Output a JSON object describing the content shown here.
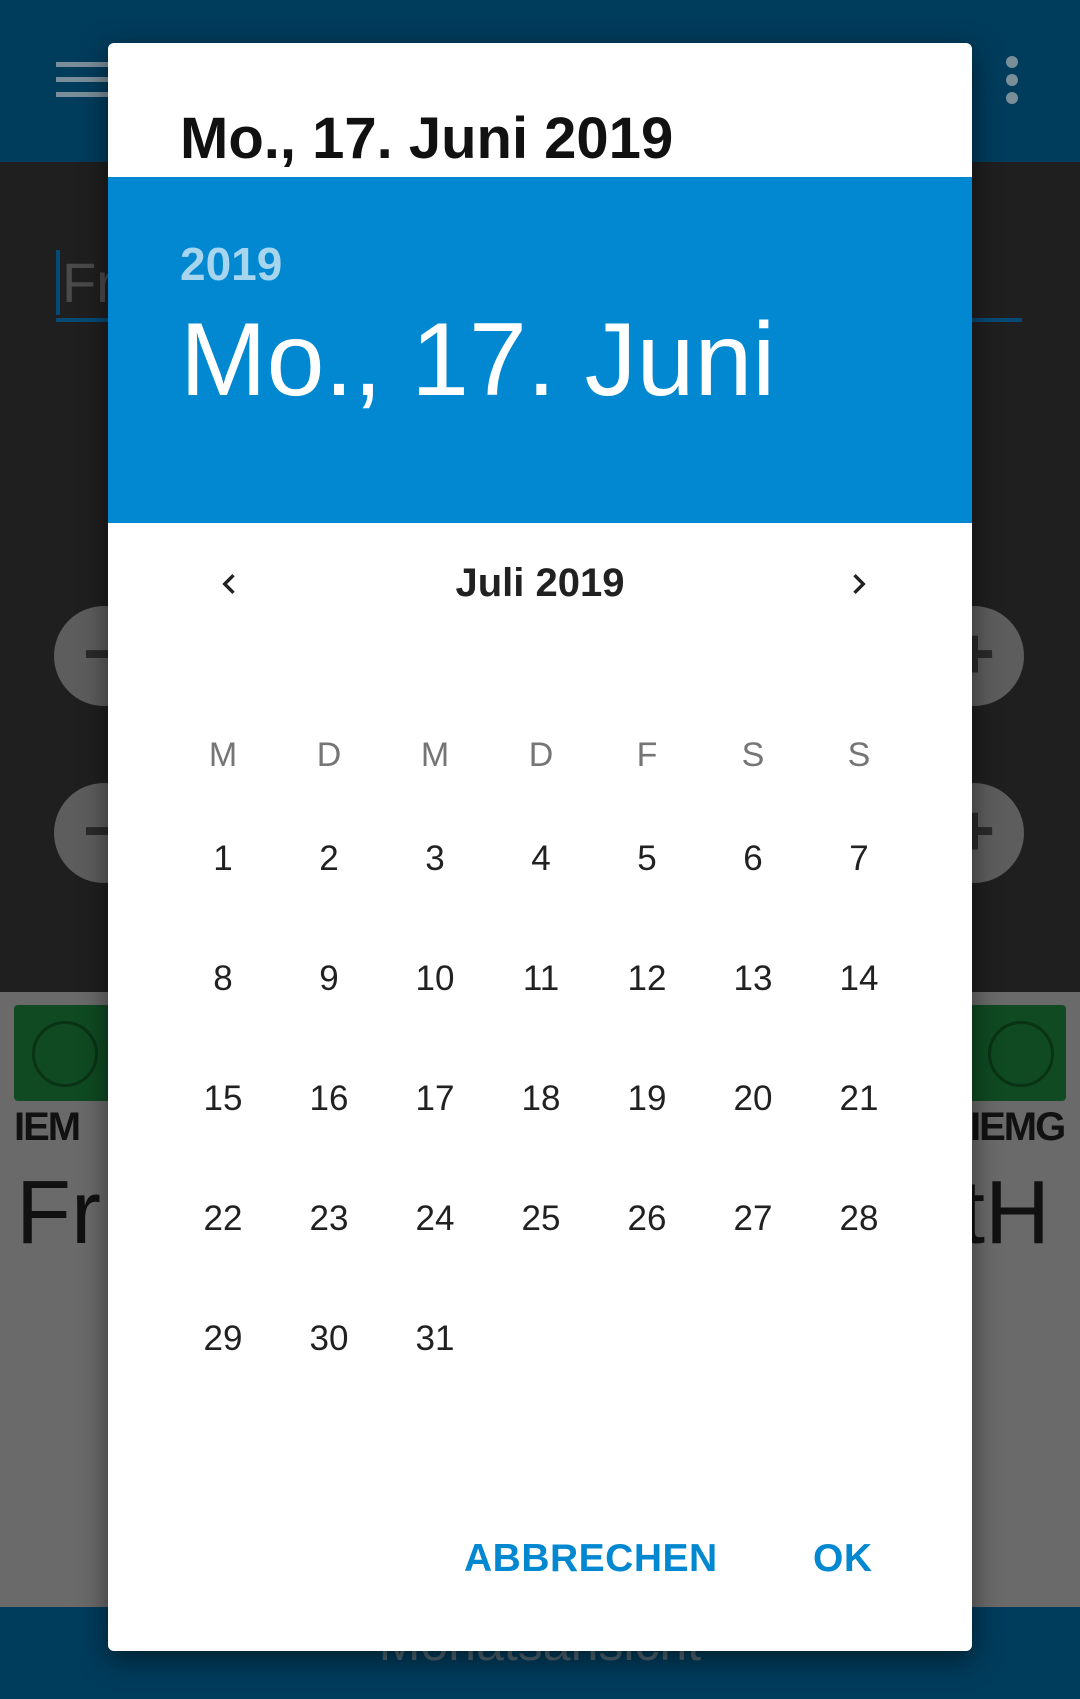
{
  "background": {
    "input_text": "Fra",
    "big_text_left": "Fr",
    "big_text_right": "tH",
    "logo_word_left": "IEM",
    "logo_word_right": "IEMG",
    "bottom_label": "Monatsansicht"
  },
  "dialog": {
    "title": "Mo., 17. Juni 2019",
    "header": {
      "year": "2019",
      "date": "Mo., 17. Juni"
    },
    "month_label": "Juli 2019",
    "weekdays": [
      "M",
      "D",
      "M",
      "D",
      "F",
      "S",
      "S"
    ],
    "days": [
      "1",
      "2",
      "3",
      "4",
      "5",
      "6",
      "7",
      "8",
      "9",
      "10",
      "11",
      "12",
      "13",
      "14",
      "15",
      "16",
      "17",
      "18",
      "19",
      "20",
      "21",
      "22",
      "23",
      "24",
      "25",
      "26",
      "27",
      "28",
      "29",
      "30",
      "31"
    ],
    "cancel_label": "ABBRECHEN",
    "ok_label": "OK"
  },
  "colors": {
    "accent": "#0288d1",
    "app_bar": "#003c5c"
  }
}
